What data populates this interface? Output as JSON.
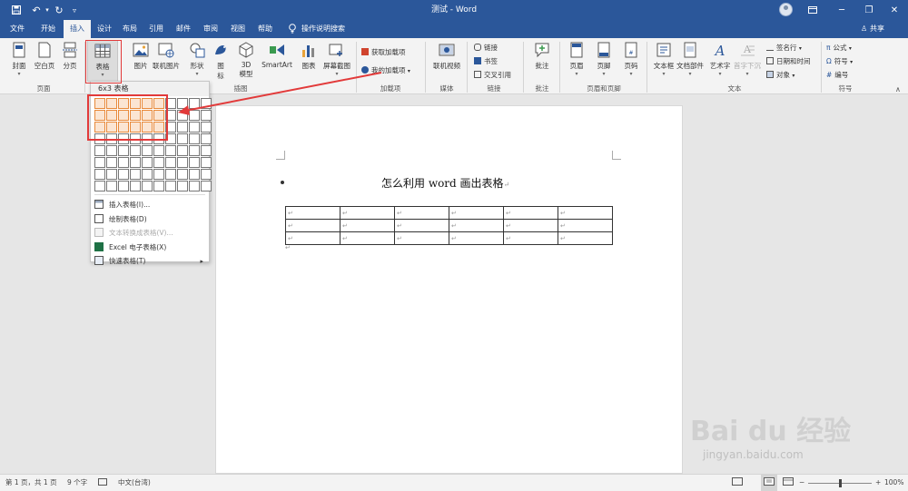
{
  "app": {
    "doc_title": "测试 - Word"
  },
  "tabs": [
    "文件",
    "开始",
    "插入",
    "设计",
    "布局",
    "引用",
    "邮件",
    "审阅",
    "视图",
    "帮助"
  ],
  "active_tab": "插入",
  "tell_me": "操作说明搜索",
  "share": "共享",
  "ribbon": {
    "groups": [
      "页面",
      "插图",
      "加载项",
      "媒体",
      "链接",
      "批注",
      "页眉和页脚",
      "文本",
      "符号"
    ],
    "pages": {
      "cover": "封面",
      "blank": "空白页",
      "break": "分页"
    },
    "table": "表格",
    "illustrations": {
      "picture": "图片",
      "online_picture": "联机图片",
      "shapes": "形状",
      "icons_line1": "图",
      "icons_line2": "标",
      "model3d_line1": "3D",
      "model3d_line2": "模型",
      "smartart": "SmartArt",
      "chart": "图表",
      "screenshot": "屏幕截图"
    },
    "addins": {
      "get": "获取加载项",
      "my": "我的加载项"
    },
    "media": {
      "online_video": "联机视频"
    },
    "links": {
      "link": "链接",
      "bookmark": "书签",
      "cross_ref": "交叉引用"
    },
    "comments": {
      "comment": "批注"
    },
    "header_footer": {
      "header": "页眉",
      "footer": "页脚",
      "page_number": "页码"
    },
    "text": {
      "textbox": "文本框",
      "quick_parts": "文档部件",
      "wordart": "艺术字",
      "dropcap": "首字下沉",
      "signature": "签名行",
      "datetime": "日期和时间",
      "object": "对象"
    },
    "symbols": {
      "equation": "公式",
      "symbol": "符号",
      "number": "编号"
    }
  },
  "dropdown": {
    "header": "6x3 表格",
    "grid_cols": 10,
    "grid_rows": 8,
    "selected_cols": 6,
    "selected_rows": 3,
    "items": [
      {
        "label": "插入表格(I)...",
        "icon": "insert-table-icon",
        "disabled": false
      },
      {
        "label": "绘制表格(D)",
        "icon": "draw-table-icon",
        "disabled": false
      },
      {
        "label": "文本转换成表格(V)...",
        "icon": "convert-text-icon",
        "disabled": true
      },
      {
        "label": "Excel 电子表格(X)",
        "icon": "excel-icon",
        "disabled": false
      },
      {
        "label": "快速表格(T)",
        "icon": "quick-table-icon",
        "disabled": false,
        "submenu": true
      }
    ]
  },
  "document": {
    "heading": "怎么利用 word 画出表格",
    "table_cols": 6,
    "table_rows": 3,
    "para_mark": "↵"
  },
  "status": {
    "page": "第 1 页，共 1 页",
    "words": "9 个字",
    "language": "中文(台湾)",
    "zoom": "100%"
  },
  "watermark": {
    "brand": "Bai du 经验",
    "url": "jingyan.baidu.com"
  },
  "colors": {
    "accent": "#2b579a",
    "highlight": "#e23a3a",
    "grid_selected": "#e8893a"
  }
}
